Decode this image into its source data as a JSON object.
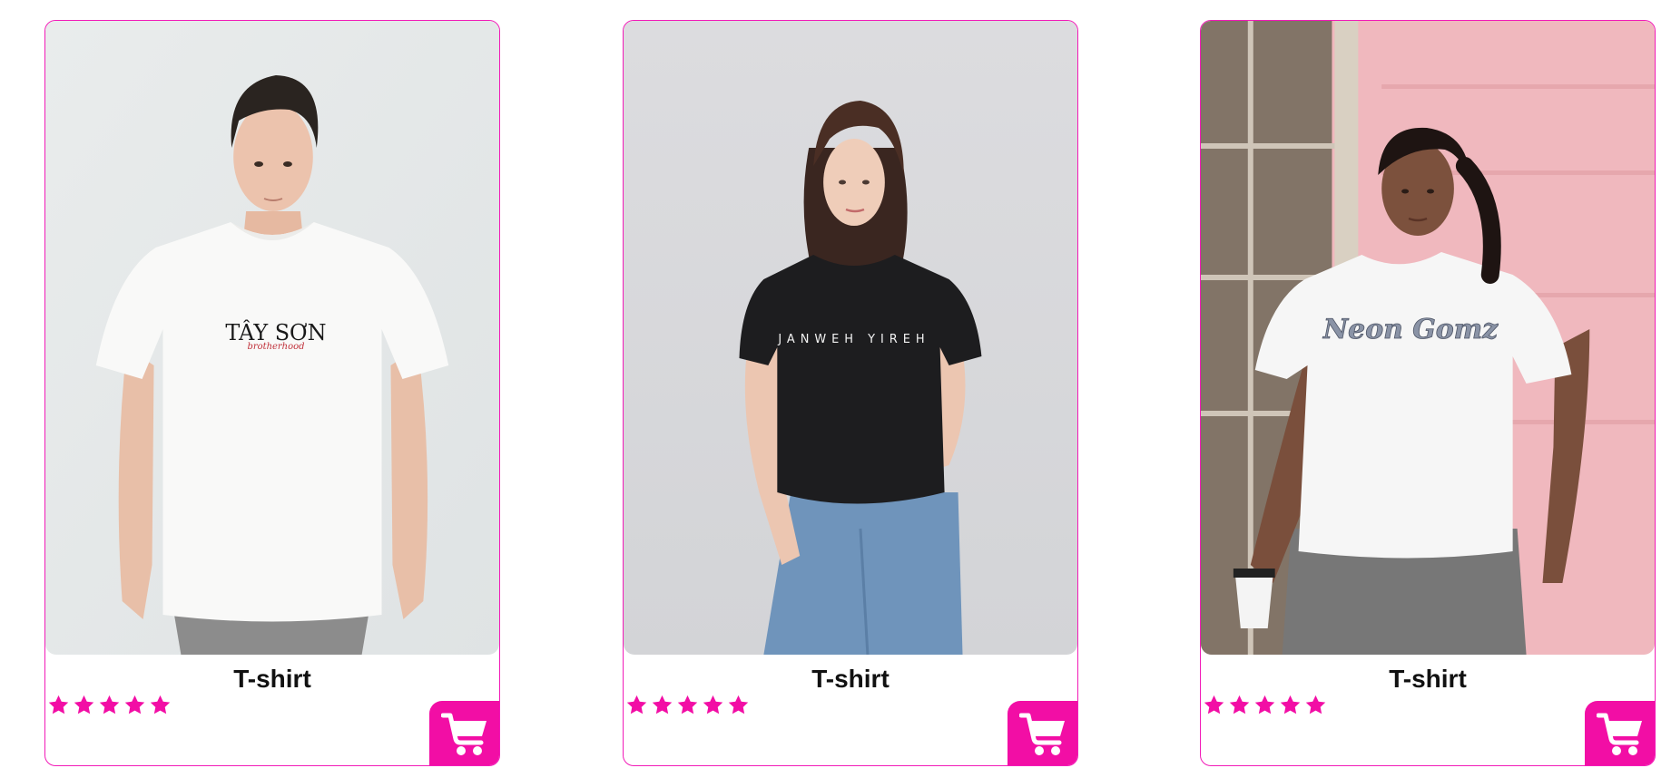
{
  "colors": {
    "accent": "#f20ea5",
    "border": "#f21bb8",
    "text": "#111111"
  },
  "products": [
    {
      "title": "T-shirt",
      "rating": 5,
      "rating_max": 5,
      "shirt_print": "TÂY SƠN",
      "shirt_print_sub": "brotherhood",
      "cart_icon": "shopping-cart-icon",
      "star_icon": "star-icon"
    },
    {
      "title": "T-shirt",
      "rating": 5,
      "rating_max": 5,
      "shirt_print": "JANWEH YIREH",
      "cart_icon": "shopping-cart-icon",
      "star_icon": "star-icon"
    },
    {
      "title": "T-shirt",
      "rating": 5,
      "rating_max": 5,
      "shirt_print": "Neon Gomz",
      "cart_icon": "shopping-cart-icon",
      "star_icon": "star-icon"
    }
  ]
}
